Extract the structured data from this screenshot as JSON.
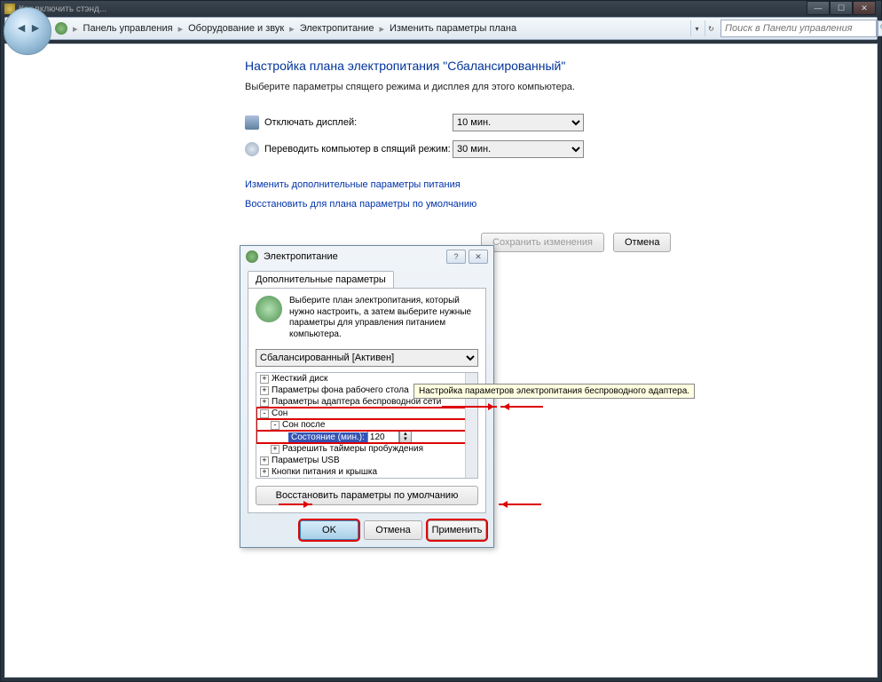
{
  "window": {
    "title": "Как включить стэнд..."
  },
  "breadcrumb": {
    "items": [
      "Панель управления",
      "Оборудование и звук",
      "Электропитание",
      "Изменить параметры плана"
    ]
  },
  "search": {
    "placeholder": "Поиск в Панели управления"
  },
  "page": {
    "title": "Настройка плана электропитания \"Сбалансированный\"",
    "subtitle": "Выберите параметры спящего режима и дисплея для этого компьютера."
  },
  "rows": {
    "display_off": {
      "label": "Отключать дисплей:",
      "value": "10 мин."
    },
    "sleep": {
      "label": "Переводить компьютер в спящий режим:",
      "value": "30 мин."
    }
  },
  "links": {
    "advanced": "Изменить дополнительные параметры питания",
    "restore_defaults": "Восстановить для плана параметры по умолчанию"
  },
  "buttons": {
    "save": "Сохранить изменения",
    "cancel": "Отмена"
  },
  "dialog": {
    "title": "Электропитание",
    "tab": "Дополнительные параметры",
    "blurb": "Выберите план электропитания, который нужно настроить, а затем выберите нужные параметры для управления питанием компьютера.",
    "plan": "Сбалансированный [Активен]",
    "tree": {
      "hdd": "Жесткий диск",
      "desktop_bg": "Параметры фона рабочего стола",
      "wireless": "Параметры адаптера беспроводной сети",
      "sleep": "Сон",
      "sleep_after": "Сон после",
      "state_label": "Состояние (мин.):",
      "state_value": "120",
      "allow_wake": "Разрешить таймеры пробуждения",
      "usb": "Параметры USB",
      "power_buttons": "Кнопки питания и крышка"
    },
    "restore": "Восстановить параметры по умолчанию",
    "footer": {
      "ok": "OK",
      "cancel": "Отмена",
      "apply": "Применить"
    }
  },
  "tooltip": "Настройка параметров электропитания беспроводного адаптера."
}
